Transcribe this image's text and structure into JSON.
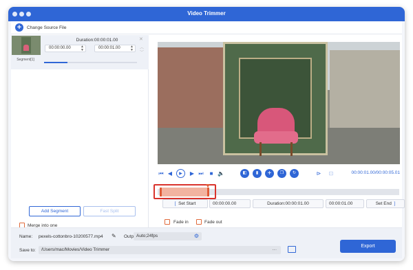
{
  "window": {
    "title": "Video Trimmer"
  },
  "topbar": {
    "add_source_label": "Change Source File",
    "add_icon": "plus-circle-icon"
  },
  "segment": {
    "duration_label": "Duration:00:00:01.00",
    "start_time": "00:00:00.00",
    "end_time": "00:00:01.00",
    "label": "Segment[1]",
    "progress": 0.25
  },
  "left_actions": {
    "add_segment_label": "Add Segment",
    "fast_split_label": "Fast Split"
  },
  "merge": {
    "label": "Merge into one",
    "checked": false
  },
  "playback": {
    "time_readout": "00:00:01.00/00:00:05.01"
  },
  "edit": {
    "set_start_label": "Set Start",
    "start_time": "00:00:00.00",
    "duration_label": "Duration:00:00:01.00",
    "end_time": "00:00:01.00",
    "set_end_label": "Set End"
  },
  "fade": {
    "fade_in_label": "Fade in",
    "fade_out_label": "Fade out"
  },
  "bottom": {
    "name_label": "Name:",
    "file_name": "pexels-cottonbro-10200577.mp4",
    "output_label": "Output:",
    "output_value": "Auto;24fps",
    "save_label": "Save to:",
    "save_path": "/Users/mac/Movies/Video Trimmer",
    "more_label": "···",
    "export_label": "Export"
  },
  "colors": {
    "accent": "#2f66d6",
    "selection": "#e05a36",
    "highlight": "#d9322b"
  }
}
